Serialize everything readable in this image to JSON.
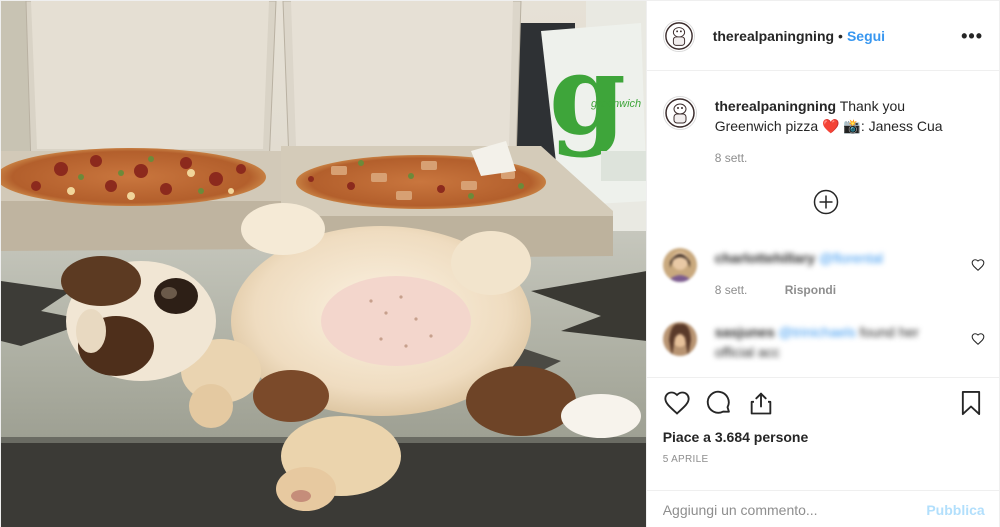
{
  "post": {
    "author": {
      "username": "therealpaningning",
      "follow_label": "Segui",
      "separator": "•",
      "more_label": "•••"
    },
    "caption": {
      "username": "therealpaningning",
      "text": "Thank you Greenwich pizza ❤️ 📸: Janess Cua",
      "time": "8 sett."
    },
    "comments": [
      {
        "username": "charlottehillary",
        "mention": "@florental",
        "text": "",
        "time": "8 sett.",
        "reply_label": "Rispondi"
      },
      {
        "username": "sasjunes",
        "mention": "@trinichaels",
        "text": "found her official acc"
      }
    ],
    "likes_text": "Piace a 3.684 persone",
    "date": "5 APRILE",
    "add_comment_placeholder": "Aggiungi un commento...",
    "publish_label": "Pubblica",
    "photo": {
      "bag_logo_letter": "g",
      "bag_logo_text": "greenwich"
    }
  },
  "colors": {
    "link_blue": "#3897f0",
    "publish_disabled": "#b2dffc",
    "secondary_text": "#8e8e8e",
    "heart_red": "#ed4956",
    "greenwich_green": "#3ea53a"
  },
  "icons": {
    "more": "more-icon",
    "load_more": "plus-circle-icon",
    "like": "heart-icon",
    "comment": "comment-icon",
    "share": "share-icon",
    "save": "bookmark-icon"
  }
}
